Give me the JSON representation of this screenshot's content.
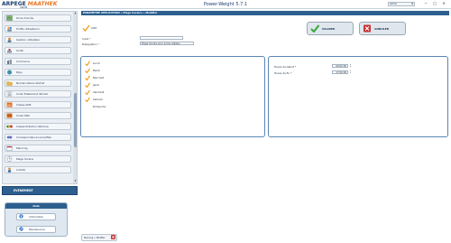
{
  "app": {
    "logo_main": "ARPEGE",
    "logo_brand": "MAATHEK",
    "logo_sub": "ONLINE",
    "title": "Power-Weight 5.7.1",
    "user": "admin"
  },
  "window": {
    "min": "−",
    "max": "□",
    "close": "✕"
  },
  "sidebar": {
    "items": [
      {
        "label": "Zone d'accès",
        "icon": "map-icon"
      },
      {
        "label": "Profils utilisateurs",
        "icon": "users-icon"
      },
      {
        "label": "Gestion utilisateur",
        "icon": "user-icon"
      },
      {
        "label": "Unité",
        "icon": "scale-icon"
      },
      {
        "label": "Commune",
        "icon": "city-icon"
      },
      {
        "label": "Pays",
        "icon": "globe-icon"
      },
      {
        "label": "Nomenclature déchet",
        "icon": "folder-icon"
      },
      {
        "label": "Code Traitement déchet",
        "icon": "list-icon"
      },
      {
        "label": "Classe ADR",
        "icon": "adr-icon"
      },
      {
        "label": "Code ONU",
        "icon": "onu-icon"
      },
      {
        "label": "Classe Pollution Véhicule",
        "icon": "car-icon"
      },
      {
        "label": "Correspondance Lancelflex",
        "icon": "link-icon"
      },
      {
        "label": "Planning",
        "icon": "calendar-icon"
      },
      {
        "label": "Plage horaire",
        "icon": "clock-icon"
      },
      {
        "label": "Civilité",
        "icon": "person-icon"
      }
    ],
    "section": "EVENEMENT"
  },
  "aide": {
    "title": "Aide",
    "information": "Information",
    "maintenance": "Maintenance"
  },
  "breadcrumb": "PARAMETRE APPLICATION  »  Plage horaire  »  Modifier",
  "form": {
    "actif_label": "Actif",
    "code_label": "Code *",
    "code_value": "",
    "designation_label": "Désignation *",
    "designation_value": "Plage horaire pour accès réglées"
  },
  "buttons": {
    "valider": "VALIDER",
    "annuler": "ANNULER"
  },
  "days": [
    {
      "label": "Lundi",
      "checked": true
    },
    {
      "label": "Mardi",
      "checked": true
    },
    {
      "label": "Mercredi",
      "checked": true
    },
    {
      "label": "Jeudi",
      "checked": true
    },
    {
      "label": "Vendredi",
      "checked": true
    },
    {
      "label": "Samedi",
      "checked": true
    },
    {
      "label": "Dimanche",
      "checked": false
    }
  ],
  "times": {
    "start_label": "Heure de début *",
    "start_value": "06:00:00",
    "end_label": "Heure de fin *",
    "end_value": "17:00:00"
  },
  "footer_tab": "Planning > Modifier",
  "colors": {
    "accent": "#2c5f8f",
    "check": "#f0a020",
    "valider": "#3aa63a",
    "annuler": "#c8312f"
  }
}
